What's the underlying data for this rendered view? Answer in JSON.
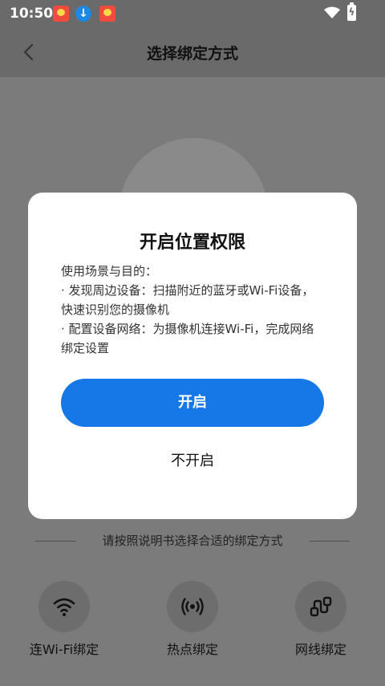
{
  "status_bar": {
    "time": "10:50",
    "notifications": [
      "app-badge-icon",
      "download-icon",
      "app-badge-icon"
    ],
    "wifi_icon": "wifi-icon",
    "battery_icon": "battery-charging-icon"
  },
  "header": {
    "title": "选择绑定方式",
    "back_icon": "chevron-left-icon"
  },
  "divider": {
    "text": "请按照说明书选择合适的绑定方式"
  },
  "bind_options": [
    {
      "label": "连Wi-Fi绑定",
      "icon": "wifi-icon"
    },
    {
      "label": "热点绑定",
      "icon": "hotspot-icon"
    },
    {
      "label": "网线绑定",
      "icon": "ethernet-icon"
    }
  ],
  "dialog": {
    "title": "开启位置权限",
    "body_lines": [
      "使用场景与目的：",
      "· 发现周边设备：扫描附近的蓝牙或Wi-Fi设备，快速识别您的摄像机",
      "· 配置设备网络：为摄像机连接Wi-Fi，完成网络绑定设置"
    ],
    "confirm_label": "开启",
    "cancel_label": "不开启"
  },
  "colors": {
    "accent": "#1677e6",
    "overlay": "#7b7b7b"
  }
}
